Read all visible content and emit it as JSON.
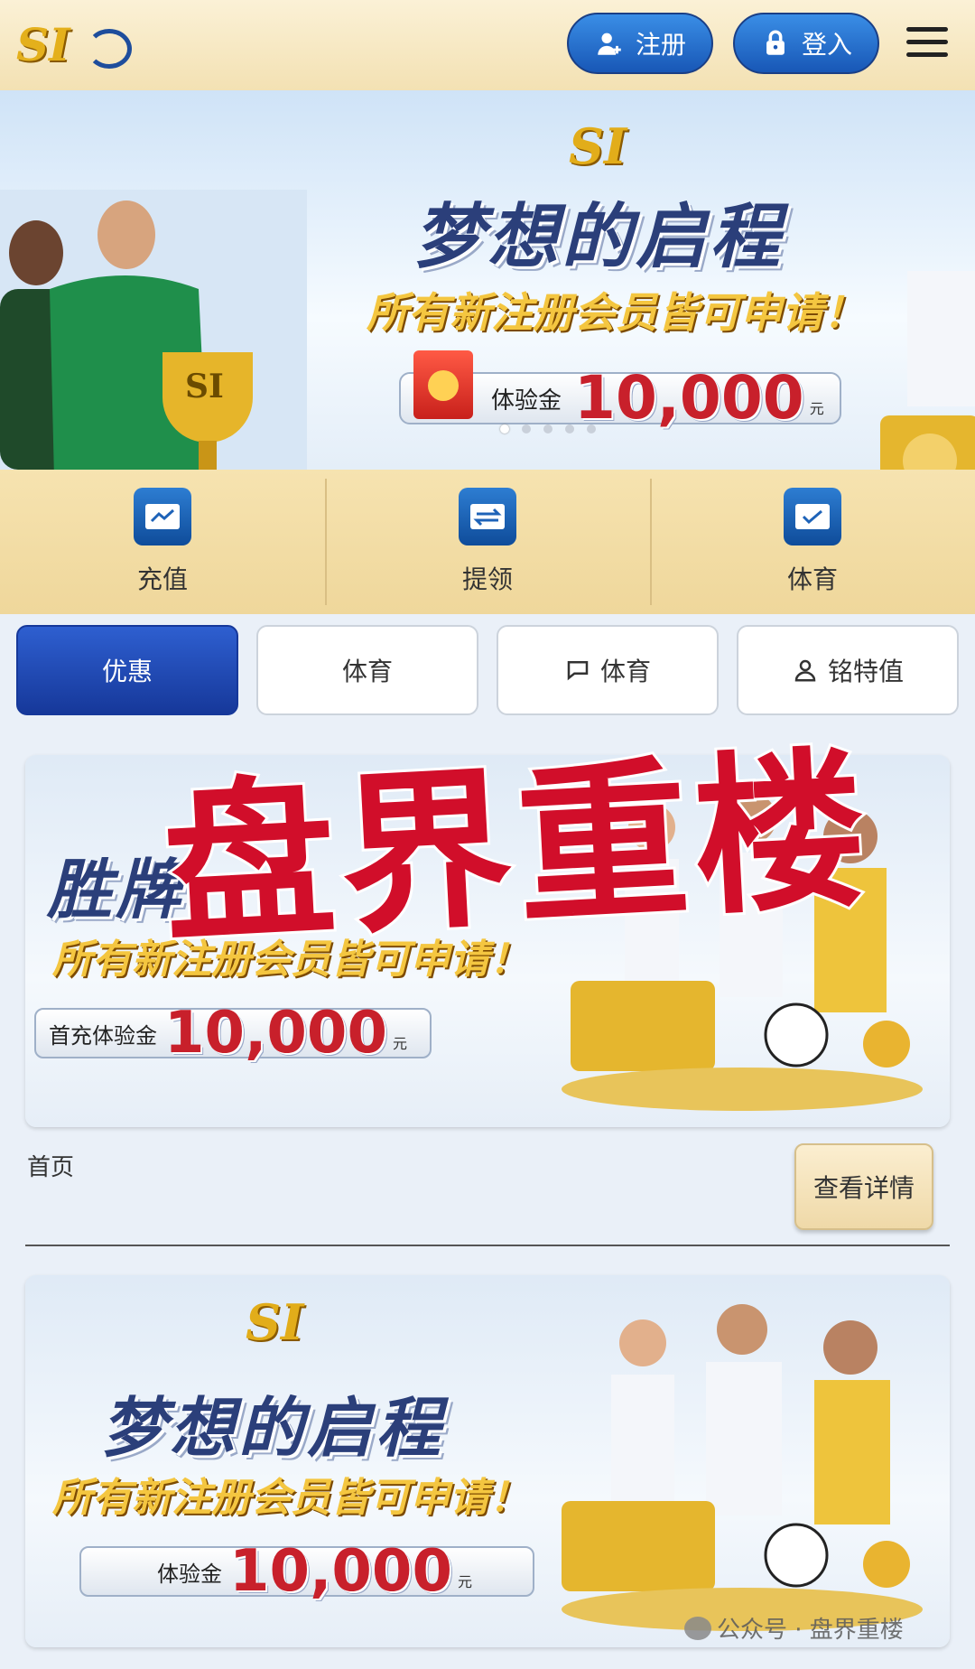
{
  "header": {
    "logo_text": "SI",
    "register_label": "注册",
    "login_label": "登入"
  },
  "banner": {
    "logo_text": "SI",
    "title": "梦想的启程",
    "subtitle": "所有新注册会员皆可申请！",
    "bonus_label": "体验金",
    "bonus_amount": "10,000",
    "bonus_unit": "元"
  },
  "quick_actions": [
    {
      "label": "充值",
      "icon": "card-icon"
    },
    {
      "label": "提领",
      "icon": "transfer-card-icon"
    },
    {
      "label": "体育",
      "icon": "card-check-icon"
    }
  ],
  "tabs": [
    {
      "label": "优惠",
      "active": true
    },
    {
      "label": "体育",
      "active": false
    },
    {
      "label": "体育",
      "active": false,
      "icon": "chat-icon"
    },
    {
      "label": "铭特值",
      "active": false,
      "icon": "user-icon"
    }
  ],
  "promo1": {
    "title": "胜牌",
    "subtitle": "所有新注册会员皆可申请！",
    "bonus_label": "首充体验金",
    "bonus_amount": "10,000",
    "bonus_unit": "元",
    "caption": "首页",
    "detail_button": "查看详情"
  },
  "promo2": {
    "logo_text": "SI",
    "title": "梦想的启程",
    "subtitle": "所有新注册会员皆可申请！",
    "bonus_label": "体验金",
    "bonus_amount": "10,000",
    "bonus_unit": "元"
  },
  "watermark": {
    "big_text": "盘界重楼",
    "small_text": "公众号 · 盘界重楼"
  },
  "colors": {
    "header_bg": "#f3e1b3",
    "accent_blue": "#16389a",
    "amount_red": "#c8202b",
    "gold": "#f4c640",
    "watermark_red": "#d10e2a"
  }
}
